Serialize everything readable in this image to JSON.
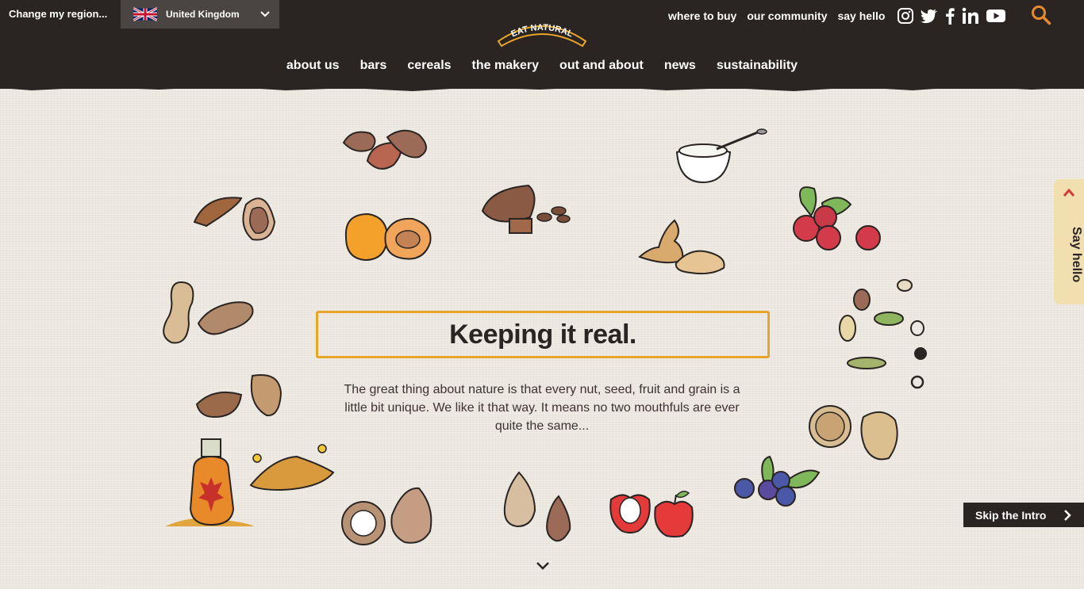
{
  "region": {
    "change_label": "Change my region...",
    "selected": "United Kingdom",
    "flag_icon": "uk-flag-icon"
  },
  "brand": {
    "logo_text": "EAT NATURAL"
  },
  "top_links": [
    "where to buy",
    "our community",
    "say hello"
  ],
  "social_icons": [
    "instagram-icon",
    "twitter-icon",
    "facebook-icon",
    "linkedin-icon",
    "youtube-icon"
  ],
  "main_nav": [
    "about us",
    "bars",
    "cereals",
    "the makery",
    "out and about",
    "news",
    "sustainability"
  ],
  "hero": {
    "headline": "Keeping it real.",
    "text": "The great thing about nature is that every nut, seed, fruit and grain is a little bit unique. We like it that way. It means no two mouthfuls are ever quite the same..."
  },
  "say_hello_tab": "Say hello",
  "skip_intro": "Skip the Intro",
  "colors": {
    "header_bg": "#2a2423",
    "accent_orange": "#e8a52a",
    "page_bg": "#efebe3",
    "tab_bg": "#f2dfb0",
    "search_orange": "#e8892a"
  }
}
